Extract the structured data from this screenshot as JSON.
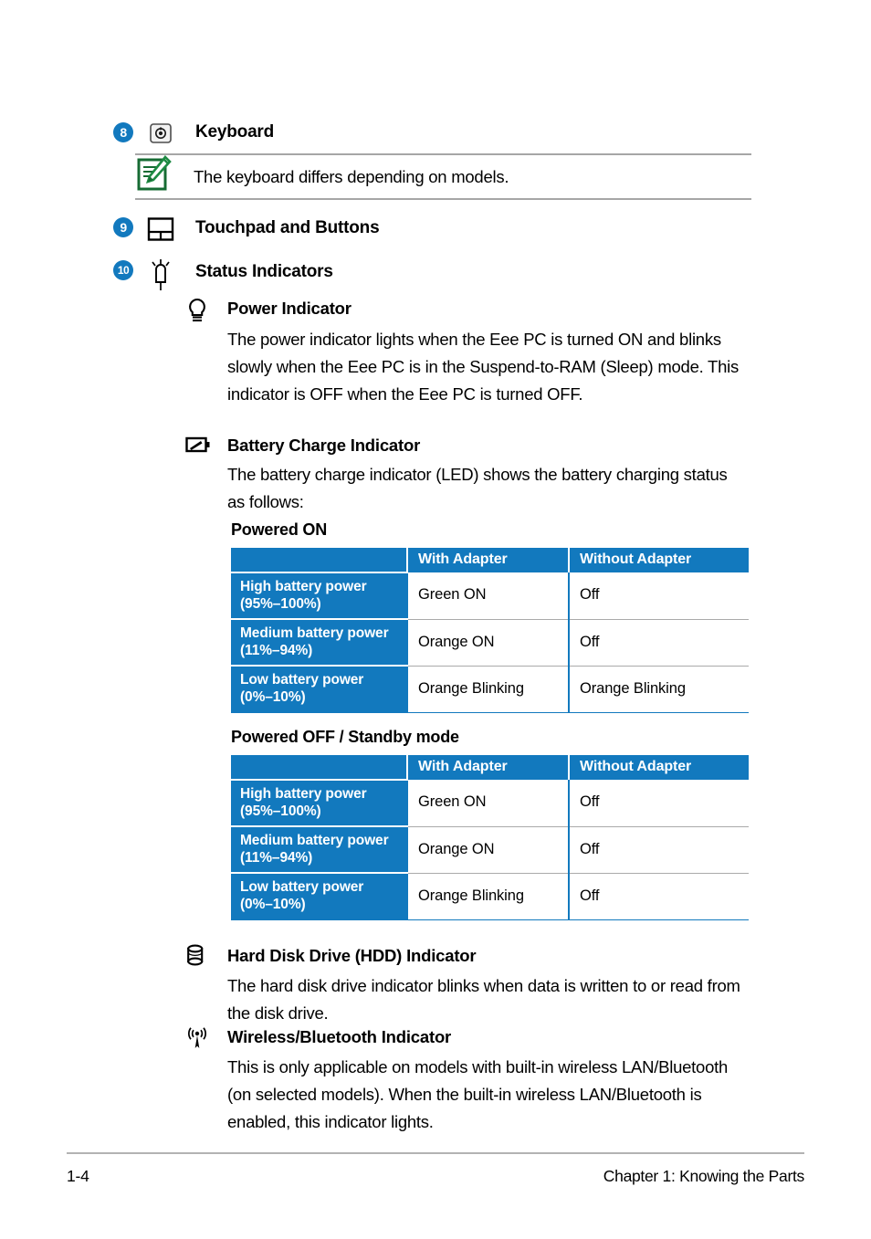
{
  "items": [
    {
      "number": "8",
      "icon": "keyboard-key-icon",
      "label": "Keyboard"
    },
    {
      "number": "9",
      "icon": "touchpad-icon",
      "label": "Touchpad and Buttons"
    },
    {
      "number": "10",
      "icon": "led-lamp-icon",
      "label": "Status Indicators"
    }
  ],
  "note": {
    "icon": "note-pencil-icon",
    "text": "The keyboard differs depending on models."
  },
  "indicators": [
    {
      "icon": "light-bulb-icon",
      "title": "Power Indicator",
      "body": "The power indicator lights when the Eee PC is turned ON and blinks slowly when the Eee PC is in the Suspend-to-RAM (Sleep) mode. This indicator is OFF when the Eee PC is turned OFF."
    },
    {
      "icon": "battery-charge-icon",
      "title": "Battery Charge Indicator",
      "body": "The battery charge indicator (LED) shows the battery charging status as follows:"
    },
    {
      "icon": "hard-disk-icon",
      "title": "Hard Disk Drive (HDD) Indicator",
      "body": "The hard disk drive indicator blinks when data is written to or read from the disk drive."
    },
    {
      "icon": "wireless-antenna-icon",
      "title": "Wireless/Bluetooth Indicator",
      "body": "This is only applicable on models with built-in wireless LAN/Bluetooth (on selected models). When the built-in wireless LAN/Bluetooth is enabled, this indicator lights."
    }
  ],
  "tables": [
    {
      "title": "Powered ON",
      "columns": [
        "",
        "With Adapter",
        "Without Adapter"
      ],
      "rows": [
        {
          "label": "High battery power (95%–100%)",
          "label_line1": "High battery power",
          "label_line2": "(95%–100%)",
          "with_adapter": "Green ON",
          "without_adapter": "Off"
        },
        {
          "label": "Medium battery power (11%–94%)",
          "label_line1": "Medium battery power",
          "label_line2": "(11%–94%)",
          "with_adapter": "Orange ON",
          "without_adapter": "Off"
        },
        {
          "label": "Low battery power (0%–10%)",
          "label_line1": "Low battery power",
          "label_line2": "(0%–10%)",
          "with_adapter": "Orange Blinking",
          "without_adapter": "Orange Blinking"
        }
      ]
    },
    {
      "title": "Powered OFF / Standby mode",
      "columns": [
        "",
        "With Adapter",
        "Without Adapter"
      ],
      "rows": [
        {
          "label": "High battery power (95%–100%)",
          "label_line1": "High battery power",
          "label_line2": "(95%–100%)",
          "with_adapter": "Green ON",
          "without_adapter": "Off"
        },
        {
          "label": "Medium battery power (11%–94%)",
          "label_line1": "Medium battery power",
          "label_line2": "(11%–94%)",
          "with_adapter": "Orange ON",
          "without_adapter": "Off"
        },
        {
          "label": "Low battery power (0%–10%)",
          "label_line1": "Low battery power",
          "label_line2": "(0%–10%)",
          "with_adapter": "Orange Blinking",
          "without_adapter": "Off"
        }
      ]
    }
  ],
  "footer": {
    "page_number": "1-4",
    "chapter": "Chapter 1: Knowing the Parts"
  },
  "colors": {
    "accent_blue": "#1279be",
    "note_green": "#1a7a3c",
    "rule_gray": "#a6a6a6"
  }
}
